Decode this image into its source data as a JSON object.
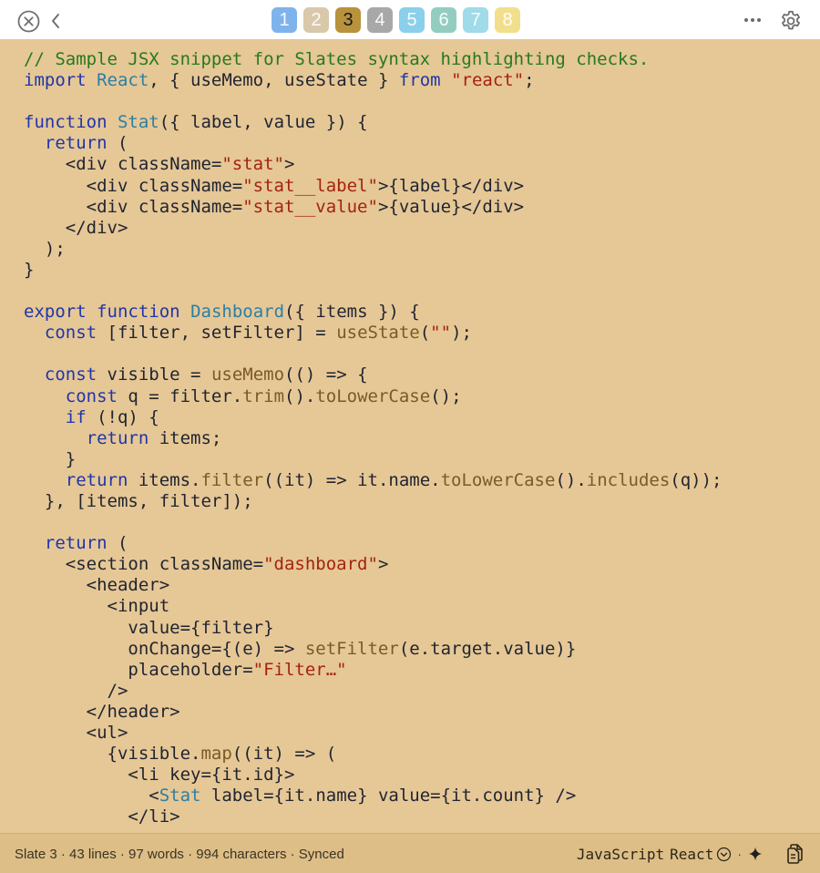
{
  "toolbar": {
    "tabs": [
      {
        "label": "1",
        "color": "#7fb3ec",
        "active": false
      },
      {
        "label": "2",
        "color": "#d9c9aa",
        "active": false
      },
      {
        "label": "3",
        "color": "#b8923c",
        "active": true
      },
      {
        "label": "4",
        "color": "#a8a8a8",
        "active": false
      },
      {
        "label": "5",
        "color": "#8ad0ea",
        "active": false
      },
      {
        "label": "6",
        "color": "#93cdc1",
        "active": false
      },
      {
        "label": "7",
        "color": "#9fdbe8",
        "active": false
      },
      {
        "label": "8",
        "color": "#f2df8c",
        "active": false
      }
    ]
  },
  "editor": {
    "lines": [
      [
        {
          "t": "// Sample JSX snippet for Slates syntax highlighting checks.",
          "c": "c"
        }
      ],
      [
        {
          "t": "import",
          "c": "k"
        },
        {
          "t": " "
        },
        {
          "t": "React",
          "c": "t"
        },
        {
          "t": ", { useMemo, useState } "
        },
        {
          "t": "from",
          "c": "k"
        },
        {
          "t": " "
        },
        {
          "t": "\"react\"",
          "c": "s"
        },
        {
          "t": ";"
        }
      ],
      [],
      [
        {
          "t": "function",
          "c": "k"
        },
        {
          "t": " "
        },
        {
          "t": "Stat",
          "c": "t"
        },
        {
          "t": "({ label, value }) {"
        }
      ],
      [
        {
          "t": "  "
        },
        {
          "t": "return",
          "c": "k"
        },
        {
          "t": " ("
        }
      ],
      [
        {
          "t": "    <div className="
        },
        {
          "t": "\"stat\"",
          "c": "s"
        },
        {
          "t": ">"
        }
      ],
      [
        {
          "t": "      <div className="
        },
        {
          "t": "\"stat__label\"",
          "c": "s"
        },
        {
          "t": ">{label}</div>"
        }
      ],
      [
        {
          "t": "      <div className="
        },
        {
          "t": "\"stat__value\"",
          "c": "s"
        },
        {
          "t": ">{value}</div>"
        }
      ],
      [
        {
          "t": "    </div>"
        }
      ],
      [
        {
          "t": "  );"
        }
      ],
      [
        {
          "t": "}"
        }
      ],
      [],
      [
        {
          "t": "export",
          "c": "k"
        },
        {
          "t": " "
        },
        {
          "t": "function",
          "c": "k"
        },
        {
          "t": " "
        },
        {
          "t": "Dashboard",
          "c": "t"
        },
        {
          "t": "({ items }) {"
        }
      ],
      [
        {
          "t": "  "
        },
        {
          "t": "const",
          "c": "k"
        },
        {
          "t": " [filter, setFilter] = "
        },
        {
          "t": "useState",
          "c": "f"
        },
        {
          "t": "("
        },
        {
          "t": "\"\"",
          "c": "s"
        },
        {
          "t": ");"
        }
      ],
      [],
      [
        {
          "t": "  "
        },
        {
          "t": "const",
          "c": "k"
        },
        {
          "t": " visible = "
        },
        {
          "t": "useMemo",
          "c": "f"
        },
        {
          "t": "(() => {"
        }
      ],
      [
        {
          "t": "    "
        },
        {
          "t": "const",
          "c": "k"
        },
        {
          "t": " q = filter."
        },
        {
          "t": "trim",
          "c": "f"
        },
        {
          "t": "()."
        },
        {
          "t": "toLowerCase",
          "c": "f"
        },
        {
          "t": "();"
        }
      ],
      [
        {
          "t": "    "
        },
        {
          "t": "if",
          "c": "k"
        },
        {
          "t": " (!q) {"
        }
      ],
      [
        {
          "t": "      "
        },
        {
          "t": "return",
          "c": "k"
        },
        {
          "t": " items;"
        }
      ],
      [
        {
          "t": "    }"
        }
      ],
      [
        {
          "t": "    "
        },
        {
          "t": "return",
          "c": "k"
        },
        {
          "t": " items."
        },
        {
          "t": "filter",
          "c": "f"
        },
        {
          "t": "((it) => it.name."
        },
        {
          "t": "toLowerCase",
          "c": "f"
        },
        {
          "t": "()."
        },
        {
          "t": "includes",
          "c": "f"
        },
        {
          "t": "(q));"
        }
      ],
      [
        {
          "t": "  }, [items, filter]);"
        }
      ],
      [],
      [
        {
          "t": "  "
        },
        {
          "t": "return",
          "c": "k"
        },
        {
          "t": " ("
        }
      ],
      [
        {
          "t": "    <section className="
        },
        {
          "t": "\"dashboard\"",
          "c": "s"
        },
        {
          "t": ">"
        }
      ],
      [
        {
          "t": "      <header>"
        }
      ],
      [
        {
          "t": "        <input"
        }
      ],
      [
        {
          "t": "          value={filter}"
        }
      ],
      [
        {
          "t": "          onChange={(e) => "
        },
        {
          "t": "setFilter",
          "c": "f"
        },
        {
          "t": "(e.target.value)}"
        }
      ],
      [
        {
          "t": "          placeholder="
        },
        {
          "t": "\"Filter…\"",
          "c": "s"
        }
      ],
      [
        {
          "t": "        />"
        }
      ],
      [
        {
          "t": "      </header>"
        }
      ],
      [
        {
          "t": "      <ul>"
        }
      ],
      [
        {
          "t": "        {visible."
        },
        {
          "t": "map",
          "c": "f"
        },
        {
          "t": "((it) => ("
        }
      ],
      [
        {
          "t": "          <li key={it.id}>"
        }
      ],
      [
        {
          "t": "            <"
        },
        {
          "t": "Stat",
          "c": "t"
        },
        {
          "t": " label={it.name} value={it.count} />"
        }
      ],
      [
        {
          "t": "          </li>"
        }
      ]
    ]
  },
  "status": {
    "summary": "Slate 3 · 43 lines · 97 words · 994 characters · Synced",
    "language": "JavaScript",
    "dialect": "React",
    "separator": "·"
  }
}
